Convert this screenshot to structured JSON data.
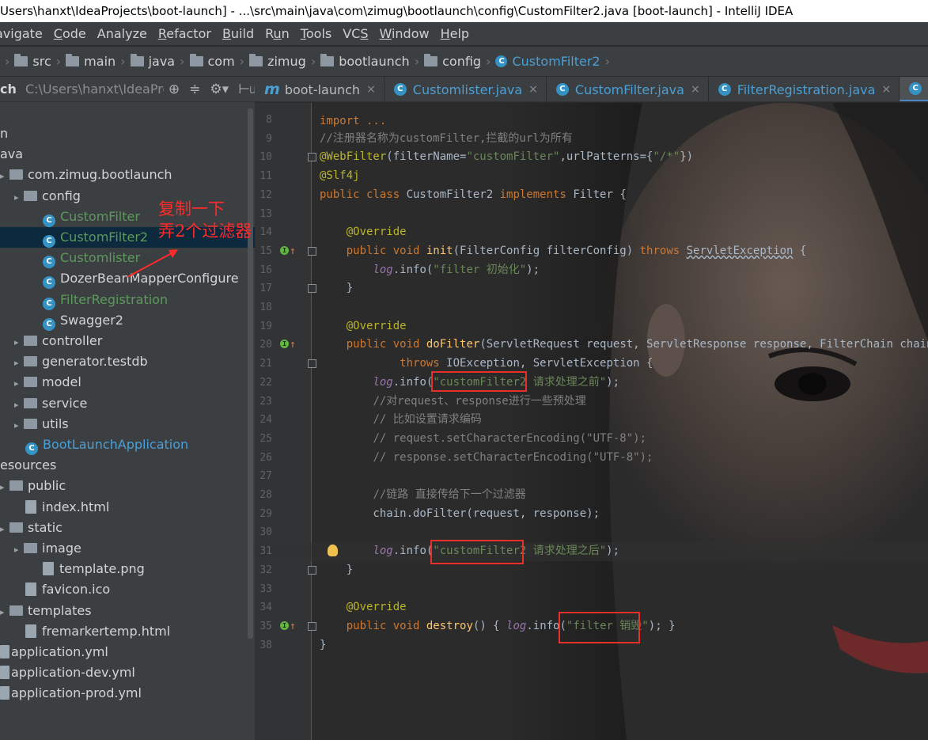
{
  "window": {
    "title": "Users\\hanxt\\IdeaProjects\\boot-launch] - ...\\src\\main\\java\\com\\zimug\\bootlaunch\\config\\CustomFilter2.java [boot-launch] - IntelliJ IDEA"
  },
  "menu": [
    {
      "label": "avigate",
      "u": ""
    },
    {
      "label": "Code",
      "u": "C"
    },
    {
      "label": "Analyze",
      "u": ""
    },
    {
      "label": "Refactor",
      "u": "R"
    },
    {
      "label": "Build",
      "u": "B"
    },
    {
      "label": "Run",
      "u": "u"
    },
    {
      "label": "Tools",
      "u": "T"
    },
    {
      "label": "VCS",
      "u": "S"
    },
    {
      "label": "Window",
      "u": "W"
    },
    {
      "label": "Help",
      "u": "H"
    }
  ],
  "breadcrumbs": [
    "src",
    "main",
    "java",
    "com",
    "zimug",
    "bootlaunch",
    "config",
    "CustomFilter2"
  ],
  "project": {
    "header_label": "ch",
    "header_path": "C:\\Users\\hanxt\\IdeaProjects\\boot-launch",
    "tree": [
      {
        "label": "n",
        "kind": "text",
        "indent": 0
      },
      {
        "label": "ava",
        "kind": "text",
        "indent": 0
      },
      {
        "label": "com.zimug.bootlaunch",
        "kind": "folder",
        "indent": 0
      },
      {
        "label": "config",
        "kind": "folder",
        "indent": 1
      },
      {
        "label": "CustomFilter",
        "kind": "class",
        "indent": 2,
        "color": "green"
      },
      {
        "label": "CustomFilter2",
        "kind": "class",
        "indent": 2,
        "color": "green",
        "selected": true
      },
      {
        "label": "Customlister",
        "kind": "class",
        "indent": 2,
        "color": "green"
      },
      {
        "label": "DozerBeanMapperConfigure",
        "kind": "class",
        "indent": 2,
        "color": "plain"
      },
      {
        "label": "FilterRegistration",
        "kind": "class",
        "indent": 2,
        "color": "green"
      },
      {
        "label": "Swagger2",
        "kind": "class",
        "indent": 2,
        "color": "plain"
      },
      {
        "label": "controller",
        "kind": "folder",
        "indent": 1
      },
      {
        "label": "generator.testdb",
        "kind": "folder",
        "indent": 1
      },
      {
        "label": "model",
        "kind": "folder",
        "indent": 1
      },
      {
        "label": "service",
        "kind": "folder",
        "indent": 1
      },
      {
        "label": "utils",
        "kind": "folder",
        "indent": 1
      },
      {
        "label": "BootLaunchApplication",
        "kind": "class",
        "indent": 1,
        "color": "moved"
      },
      {
        "label": "esources",
        "kind": "text",
        "indent": 0
      },
      {
        "label": "public",
        "kind": "folder",
        "indent": 0
      },
      {
        "label": "index.html",
        "kind": "file",
        "indent": 1
      },
      {
        "label": "static",
        "kind": "folder",
        "indent": 0
      },
      {
        "label": "image",
        "kind": "folder",
        "indent": 1
      },
      {
        "label": "template.png",
        "kind": "file",
        "indent": 2
      },
      {
        "label": "favicon.ico",
        "kind": "file",
        "indent": 1
      },
      {
        "label": "templates",
        "kind": "folder",
        "indent": 0
      },
      {
        "label": "fremarkertemp.html",
        "kind": "file",
        "indent": 1
      },
      {
        "label": "application.yml",
        "kind": "yml",
        "indent": 0
      },
      {
        "label": "application-dev.yml",
        "kind": "yml",
        "indent": 0
      },
      {
        "label": "application-prod.yml",
        "kind": "yml",
        "indent": 0
      }
    ]
  },
  "annotation": {
    "line1": "复制一下",
    "line2": "弄2个过滤器"
  },
  "tabs": [
    {
      "label": "boot-launch",
      "icon": "m",
      "active": false
    },
    {
      "label": "Customlister.java",
      "icon": "c",
      "active": false
    },
    {
      "label": "CustomFilter.java",
      "icon": "c",
      "active": false,
      "blue": true
    },
    {
      "label": "FilterRegistration.java",
      "icon": "c",
      "active": false
    },
    {
      "label": "CustomFil",
      "icon": "c",
      "active": true
    }
  ],
  "code": {
    "top_fragment": "import ...",
    "lines": [
      {
        "n": "8",
        "html": ""
      },
      {
        "n": "9",
        "parts": [
          [
            "cmt",
            "//注册器名称为customFilter,拦截的url为所有"
          ]
        ]
      },
      {
        "n": "10",
        "parts": [
          [
            "ann",
            "@WebFilter"
          ],
          [
            "",
            "(filterName="
          ],
          [
            "str",
            "\"customFilter\""
          ],
          [
            "",
            ",urlPatterns={"
          ],
          [
            "str",
            "\"/*\""
          ],
          [
            "",
            "})"
          ]
        ]
      },
      {
        "n": "11",
        "parts": [
          [
            "ann",
            "@Slf4j"
          ]
        ]
      },
      {
        "n": "12",
        "parts": [
          [
            "kw",
            "public class "
          ],
          [
            "",
            "CustomFilter2 "
          ],
          [
            "kw",
            "implements "
          ],
          [
            "",
            "Filter {"
          ]
        ]
      },
      {
        "n": "13",
        "parts": []
      },
      {
        "n": "14",
        "parts": [
          [
            "",
            "    "
          ],
          [
            "ann",
            "@Override"
          ]
        ]
      },
      {
        "n": "15",
        "parts": [
          [
            "",
            "    "
          ],
          [
            "kw",
            "public void "
          ],
          [
            "method",
            "init"
          ],
          [
            "",
            "(FilterConfig filterConfig) "
          ],
          [
            "kw",
            "throws "
          ],
          [
            "uw",
            "ServletException"
          ],
          [
            "",
            " {"
          ]
        ]
      },
      {
        "n": "16",
        "parts": [
          [
            "",
            "        "
          ],
          [
            "logv",
            "log"
          ],
          [
            "",
            ".info("
          ],
          [
            "str",
            "\"filter 初始化\""
          ],
          [
            "",
            ");"
          ]
        ]
      },
      {
        "n": "17",
        "parts": [
          [
            "",
            "    }"
          ]
        ]
      },
      {
        "n": "18",
        "parts": []
      },
      {
        "n": "19",
        "parts": [
          [
            "",
            "    "
          ],
          [
            "ann",
            "@Override"
          ]
        ]
      },
      {
        "n": "20",
        "parts": [
          [
            "",
            "    "
          ],
          [
            "kw",
            "public void "
          ],
          [
            "method",
            "doFilter"
          ],
          [
            "",
            "(ServletRequest request, ServletResponse response, FilterChain chain)"
          ]
        ]
      },
      {
        "n": "21",
        "parts": [
          [
            "",
            "            "
          ],
          [
            "kw",
            "throws "
          ],
          [
            "",
            "IOException, ServletException {"
          ]
        ]
      },
      {
        "n": "22",
        "parts": [
          [
            "",
            "        "
          ],
          [
            "logv",
            "log"
          ],
          [
            "",
            ".info("
          ],
          [
            "str",
            "\"customFilter2 请求处理之前\""
          ],
          [
            "",
            ");"
          ]
        ]
      },
      {
        "n": "23",
        "parts": [
          [
            "",
            "        "
          ],
          [
            "cmt",
            "//对request、response进行一些预处理"
          ]
        ]
      },
      {
        "n": "24",
        "parts": [
          [
            "",
            "        "
          ],
          [
            "cmt",
            "// 比如设置请求编码"
          ]
        ]
      },
      {
        "n": "25",
        "parts": [
          [
            "",
            "        "
          ],
          [
            "cmt",
            "// request.setCharacterEncoding(\"UTF-8\");"
          ]
        ]
      },
      {
        "n": "26",
        "parts": [
          [
            "",
            "        "
          ],
          [
            "cmt",
            "// response.setCharacterEncoding(\"UTF-8\");"
          ]
        ]
      },
      {
        "n": "27",
        "parts": []
      },
      {
        "n": "28",
        "parts": [
          [
            "",
            "        "
          ],
          [
            "cmt",
            "//链路 直接传给下一个过滤器"
          ]
        ]
      },
      {
        "n": "29",
        "parts": [
          [
            "",
            "        chain.doFilter(request, response);"
          ]
        ]
      },
      {
        "n": "30",
        "parts": []
      },
      {
        "n": "31",
        "parts": [
          [
            "",
            "        "
          ],
          [
            "logv",
            "log"
          ],
          [
            "",
            ".info("
          ],
          [
            "str",
            "\"customFilter2 请求处理之后\""
          ],
          [
            "",
            ");"
          ]
        ]
      },
      {
        "n": "32",
        "parts": [
          [
            "",
            "    }"
          ]
        ]
      },
      {
        "n": "33",
        "parts": []
      },
      {
        "n": "34",
        "parts": [
          [
            "",
            "    "
          ],
          [
            "ann",
            "@Override"
          ]
        ]
      },
      {
        "n": "35",
        "parts": [
          [
            "",
            "    "
          ],
          [
            "kw",
            "public void "
          ],
          [
            "method",
            "destroy"
          ],
          [
            "",
            "() { "
          ],
          [
            "logv",
            "log"
          ],
          [
            "",
            ".info("
          ],
          [
            "str",
            "\"filter 销毁\""
          ],
          [
            "",
            "); }"
          ]
        ]
      },
      {
        "n": "38",
        "parts": [
          [
            "",
            "}"
          ]
        ]
      }
    ]
  },
  "colors": {
    "keyword": "#cc7832",
    "annotation": "#bbb529",
    "string": "#6a8759",
    "comment": "#808080",
    "highlight_box": "#e8302a",
    "annotation_text": "#ff2a2a"
  }
}
